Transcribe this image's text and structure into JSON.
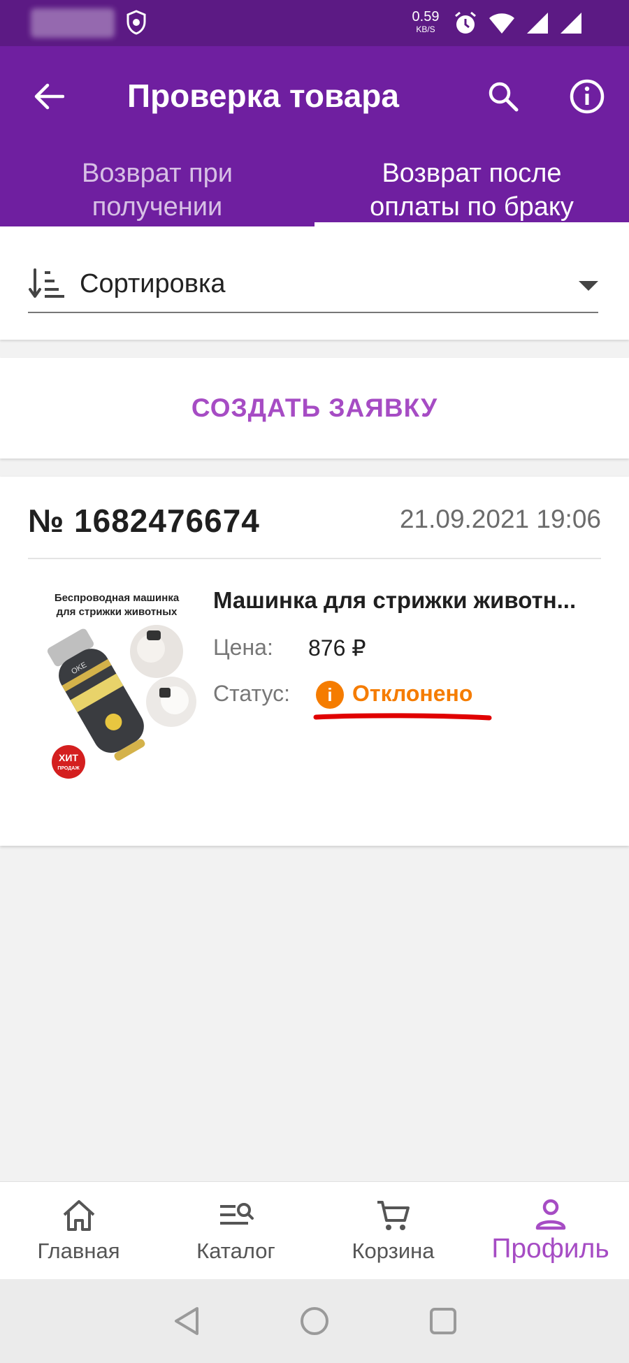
{
  "status_bar": {
    "speed_value": "0.59",
    "speed_unit": "KB/S"
  },
  "app_bar": {
    "title": "Проверка товара",
    "tabs": [
      {
        "label": "Возврат при получении",
        "active": false
      },
      {
        "label": "Возврат после оплаты по браку",
        "active": true
      }
    ]
  },
  "sort": {
    "label": "Сортировка"
  },
  "create_request": {
    "label": "СОЗДАТЬ ЗАЯВКУ"
  },
  "order": {
    "number": "№ 1682476674",
    "date": "21.09.2021 19:06",
    "product": {
      "name": "Машинка для стрижки животн...",
      "image_caption_line1": "Беспроводная машинка",
      "image_caption_line2": "для стрижки животных",
      "image_badge": "ХИТ",
      "image_badge_sub": "ПРОДАЖ",
      "price_label": "Цена:",
      "price_value": "876 ₽",
      "status_label": "Статус:",
      "status_value": "Отклонено",
      "status_icon": "i"
    }
  },
  "bottom_nav": {
    "items": [
      {
        "label": "Главная",
        "icon": "home-icon",
        "active": false
      },
      {
        "label": "Каталог",
        "icon": "catalog-search-icon",
        "active": false
      },
      {
        "label": "Корзина",
        "icon": "cart-icon",
        "active": false
      },
      {
        "label": "Профиль",
        "icon": "profile-icon",
        "active": true
      }
    ]
  },
  "colors": {
    "status_bar": "#5c1a84",
    "app_bar": "#6f1fa0",
    "accent": "#a64cc4",
    "status_rejected": "#f57c00",
    "annotation_underline": "#e00000"
  }
}
